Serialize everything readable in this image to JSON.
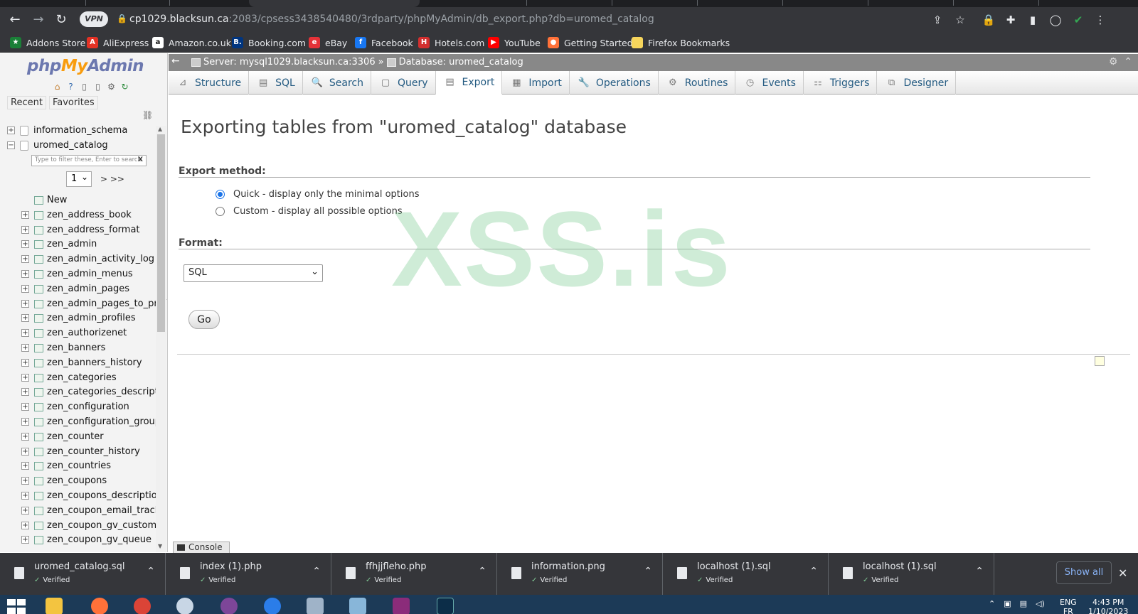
{
  "browser": {
    "url_host": "cp1029.blacksun.ca",
    "url_rest": ":2083/cpsess3438540480/3rdparty/phpMyAdmin/db_export.php?db=uromed_catalog",
    "vpn_label": "VPN",
    "bookmarks": [
      {
        "label": "Addons Store",
        "color": "#1a7f37",
        "glyph": "★"
      },
      {
        "label": "AliExpress",
        "color": "#e43225",
        "glyph": "A"
      },
      {
        "label": "Amazon.co.uk",
        "color": "#ffffff",
        "glyph": "a"
      },
      {
        "label": "Booking.com",
        "color": "#003580",
        "glyph": "B."
      },
      {
        "label": "eBay",
        "color": "#e53238",
        "glyph": "e"
      },
      {
        "label": "Facebook",
        "color": "#1877f2",
        "glyph": "f"
      },
      {
        "label": "Hotels.com",
        "color": "#d32f2f",
        "glyph": "H"
      },
      {
        "label": "YouTube",
        "color": "#ff0000",
        "glyph": "▶"
      },
      {
        "label": "Getting Started",
        "color": "#ff7139",
        "glyph": "●"
      },
      {
        "label": "Firefox Bookmarks",
        "color": "#f6d55c",
        "glyph": ""
      }
    ]
  },
  "nav": {
    "logo_php": "php",
    "logo_my": "My",
    "logo_admin": "Admin",
    "recent": "Recent",
    "favorites": "Favorites",
    "databases": [
      {
        "name": "information_schema",
        "expander": "+"
      },
      {
        "name": "uromed_catalog",
        "expander": "−"
      }
    ],
    "filter_placeholder": "Type to filter these, Enter to search",
    "filter_clear": "X",
    "page_select": "1",
    "page_next": "> >>",
    "new_label": "New",
    "tables": [
      "zen_address_book",
      "zen_address_format",
      "zen_admin",
      "zen_admin_activity_log",
      "zen_admin_menus",
      "zen_admin_pages",
      "zen_admin_pages_to_prof",
      "zen_admin_profiles",
      "zen_authorizenet",
      "zen_banners",
      "zen_banners_history",
      "zen_categories",
      "zen_categories_descriptio",
      "zen_configuration",
      "zen_configuration_group",
      "zen_counter",
      "zen_counter_history",
      "zen_countries",
      "zen_coupons",
      "zen_coupons_description",
      "zen_coupon_email_track",
      "zen_coupon_gv_customer",
      "zen_coupon_gv_queue"
    ]
  },
  "breadcrumb": {
    "server": "Server: mysql1029.blacksun.ca:3306",
    "separator": "»",
    "database": "Database: uromed_catalog"
  },
  "tabs": [
    {
      "label": "Structure",
      "icon": "⊿"
    },
    {
      "label": "SQL",
      "icon": "▤"
    },
    {
      "label": "Search",
      "icon": "🔍"
    },
    {
      "label": "Query",
      "icon": "▢"
    },
    {
      "label": "Export",
      "icon": "▤"
    },
    {
      "label": "Import",
      "icon": "▦"
    },
    {
      "label": "Operations",
      "icon": "🔧"
    },
    {
      "label": "Routines",
      "icon": "⚙"
    },
    {
      "label": "Events",
      "icon": "◷"
    },
    {
      "label": "Triggers",
      "icon": "⚏"
    },
    {
      "label": "Designer",
      "icon": "⧉"
    }
  ],
  "active_tab": "Export",
  "main": {
    "title": "Exporting tables from \"uromed_catalog\" database",
    "export_method_heading": "Export method:",
    "method_quick": "Quick - display only the minimal options",
    "method_custom": "Custom - display all possible options",
    "selected_method": "quick",
    "format_heading": "Format:",
    "format_value": "SQL",
    "go_label": "Go",
    "watermark": "XSS.is",
    "console_label": "Console"
  },
  "downloads": {
    "items": [
      {
        "name": "uromed_catalog.sql",
        "status": "Verified"
      },
      {
        "name": "index (1).php",
        "status": "Verified"
      },
      {
        "name": "ffhjjfleho.php",
        "status": "Verified"
      },
      {
        "name": "information.png",
        "status": "Verified"
      },
      {
        "name": "localhost (1).sql",
        "status": "Verified"
      },
      {
        "name": "localhost (1).sql",
        "status": "Verified"
      }
    ],
    "show_all": "Show all"
  },
  "taskbar": {
    "lang": "ENG",
    "lang_sub": "FR",
    "time": "4:43 PM",
    "date": "1/10/2023"
  }
}
